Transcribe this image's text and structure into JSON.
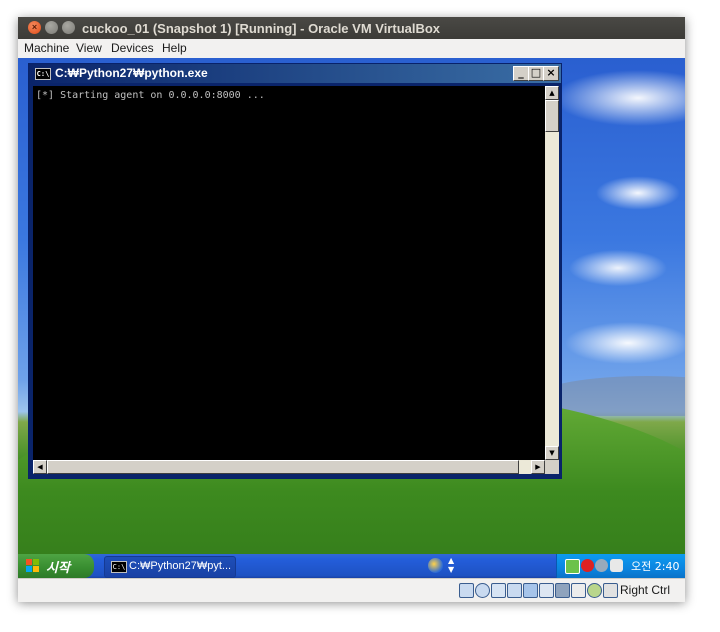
{
  "vbox": {
    "title": "cuckoo_01 (Snapshot 1) [Running] - Oracle VM VirtualBox",
    "close_glyph": "×",
    "menu": [
      "Machine",
      "View",
      "Devices",
      "Help"
    ],
    "status_icons": [
      "hard-disk-icon",
      "optical-drive-icon",
      "usb-icon",
      "network-icon",
      "shared-folders-icon",
      "display-icon",
      "video-capture-icon",
      "virtualization-icon",
      "mouse-integration-icon",
      "keyboard-icon"
    ],
    "host_key": "Right Ctrl"
  },
  "cmd": {
    "icon_text": "C:\\",
    "title": "C:₩Python27₩python.exe",
    "buttons": {
      "minimize": "_",
      "maximize": "□",
      "close": "×"
    },
    "output": "[*] Starting agent on 0.0.0.0:8000 ...",
    "scroll_up": "▲",
    "scroll_down": "▼",
    "scroll_left": "◀",
    "scroll_right": "▶"
  },
  "taskbar": {
    "start_label": "시작",
    "task_label": "C:₩Python27₩pyt...",
    "lang_arrow": "▲\n▼",
    "clock": "오전 2:40",
    "tray_icons": [
      "security-center-icon",
      "antivirus-icon",
      "network-tray-icon",
      "update-tray-icon"
    ]
  },
  "colors": {
    "xp_taskbar": "#245edb",
    "xp_start": "#378c2f",
    "xp_title": "#0a246a",
    "ubuntu_titlebar": "#3c3b37",
    "ubuntu_close": "#df4a16"
  }
}
